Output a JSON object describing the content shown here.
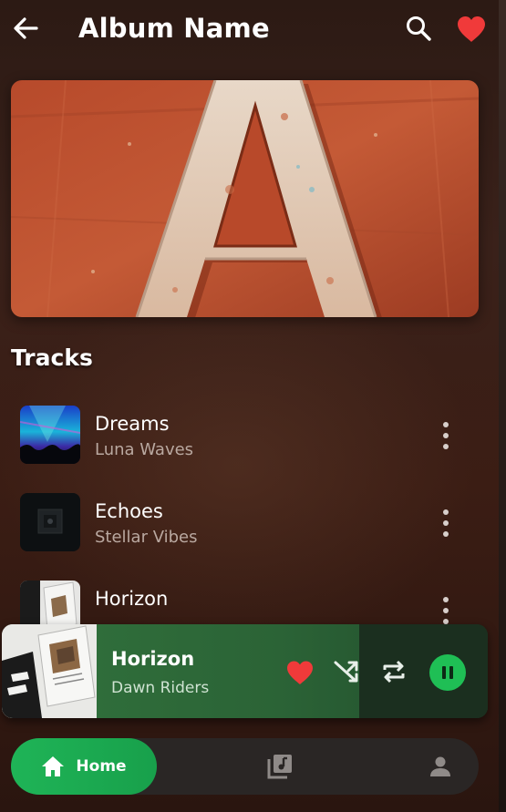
{
  "header": {
    "title": "Album Name",
    "back_icon": "arrow-left-icon",
    "search_icon": "search-icon",
    "favorite_icon": "heart-icon"
  },
  "cover": {
    "description_icon": "album-cover-art"
  },
  "tracks_heading": "Tracks",
  "tracks": [
    {
      "title": "Dreams",
      "artist": "Luna Waves"
    },
    {
      "title": "Echoes",
      "artist": "Stellar Vibes"
    },
    {
      "title": "Horizon",
      "artist": ""
    }
  ],
  "now_playing": {
    "title": "Horizon",
    "artist": "Dawn Riders",
    "liked": true,
    "playing": true
  },
  "nav": {
    "home_label": "Home",
    "items": [
      "home-icon",
      "library-icon",
      "profile-icon"
    ]
  },
  "colors": {
    "accent": "#1fbf55",
    "heart": "#f03a3a",
    "background": "#3a211a"
  }
}
